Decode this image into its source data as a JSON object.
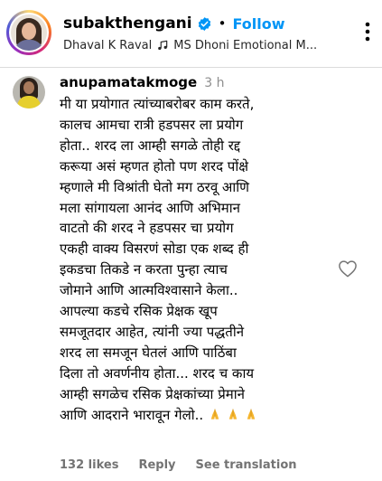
{
  "post": {
    "username": "subakthengani",
    "follow_label": "Follow",
    "audio": {
      "artist": "Dhaval K Raval",
      "title": "MS Dhoni Emotional M..."
    }
  },
  "comment": {
    "username": "anupamatakmoge",
    "time": "3 h",
    "lines": [
      "मी या प्रयोगात त्यांच्याबरोबर काम करते,",
      "कालच आमचा रात्री हडपसर ला प्रयोग",
      "होता.. शरद ला आम्ही सगळे तोही रद्द",
      "करूया असं म्हणत होतो पण शरद पोंक्षे",
      "म्हणाले मी विश्रांती घेतो मग ठरवू आणि",
      "मला सांगायला आनंद आणि अभिमान",
      "वाटतो की शरद ने हडपसर चा प्रयोग",
      "एकही वाक्य विसरणं सोडा एक शब्द ही",
      "इकडचा तिकडे न करता पुन्हा त्याच",
      "जोमाने आणि आत्मविश्वासाने केला..",
      "आपल्या कडचे रसिक प्रेक्षक खूप",
      "समजूतदार आहेत, त्यांनी ज्या पद्धतीने",
      "शरद ला समजून घेतलं आणि पाठिंबा",
      "दिला तो अवर्णनीय होता... शरद च काय",
      "आम्ही सगळेच रसिक प्रेक्षकांच्या प्रेमाने",
      "आणि आदराने भारावून गेलो.."
    ],
    "emoji_icons": [
      "folded-hands-icon",
      "folded-hands-icon",
      "folded-hands-icon"
    ],
    "likes_label": "132 likes",
    "reply_label": "Reply",
    "translation_label": "See translation"
  },
  "colors": {
    "accent": "#0095f6",
    "secondary_text": "#737373",
    "verified": "#0095f6",
    "emoji": "#f5b52e"
  }
}
